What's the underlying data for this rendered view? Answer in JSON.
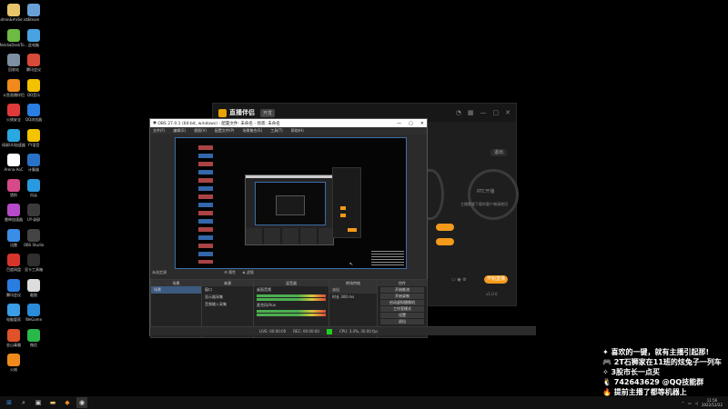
{
  "desktop_icons": [
    {
      "label": "admin&#x6e;istr...",
      "color": "#e8c46a"
    },
    {
      "label": "Steam",
      "color": "#6aa0d8"
    },
    {
      "label": "NvIdiaDeskTo...",
      "color": "#6dbb42"
    },
    {
      "label": "此电脑",
      "color": "#4aa3e0"
    },
    {
      "label": "回收站",
      "color": "#7d8fa0"
    },
    {
      "label": "腾讯会议",
      "color": "#d84a3a"
    },
    {
      "label": "斗鱼直播伴侣",
      "color": "#f08a1c"
    },
    {
      "label": "QQ音乐",
      "color": "#f2c200"
    },
    {
      "label": "火绒安全",
      "color": "#e03a3a"
    },
    {
      "label": "QQ浏览器",
      "color": "#2a7de1"
    },
    {
      "label": "网易UU加速器",
      "color": "#2aa8e0"
    },
    {
      "label": "YY语音",
      "color": "#f5c400"
    },
    {
      "label": "Arena-AoC",
      "color": "#ffffff"
    },
    {
      "label": "计算器",
      "color": "#2a72c8"
    },
    {
      "label": "猎豹",
      "color": "#d64a8a"
    },
    {
      "label": "风云",
      "color": "#2a9ae0"
    },
    {
      "label": "雷神加速器",
      "color": "#b74ac8"
    },
    {
      "label": "UY-录屏",
      "color": "#3a3a3a"
    },
    {
      "label": "迅雷",
      "color": "#3a8ee6"
    },
    {
      "label": "OBS Studio",
      "color": "#444444"
    },
    {
      "label": "百度网盘",
      "color": "#d7352a"
    },
    {
      "label": "显卡工具箱",
      "color": "#2f2f2f"
    },
    {
      "label": "腾讯会议",
      "color": "#2a7de1"
    },
    {
      "label": "截图",
      "color": "#dddddd"
    },
    {
      "label": "电脑管家",
      "color": "#3a9ee6"
    },
    {
      "label": "WeGame",
      "color": "#2a8bd8"
    },
    {
      "label": "金山毒霸",
      "color": "#e0532a"
    },
    {
      "label": "微信",
      "color": "#2ab84a"
    },
    {
      "label": "火绒",
      "color": "#f08a1c"
    }
  ],
  "helper_app": {
    "title": "直播伴侣",
    "badge": "开发",
    "small_btn": "退出",
    "circle_label": "RTC开播",
    "circle_sub": "主播需要下载的客户端请使用",
    "orange_buttons": [
      "",
      ""
    ],
    "start_button": "开始直播",
    "version_text": "v1.0.0"
  },
  "obs": {
    "title_bar": "OBS 27.0.1 (64-bit, windows) - 配置文件: 未命名 - 场景: 未命名",
    "menu": [
      "文件(F)",
      "编辑(E)",
      "视图(V)",
      "配置文件(P)",
      "场景集合(S)",
      "工具(T)",
      "帮助(H)"
    ],
    "scene_toolbar": "未选定源",
    "props_label": "属性",
    "filters_label": "滤镜",
    "docks": {
      "scenes": {
        "title": "场景",
        "items": [
          "场景"
        ]
      },
      "sources": {
        "title": "来源",
        "items": [
          "窗口",
          "显示器采集",
          "音频输入采集"
        ]
      },
      "mixer": {
        "title": "混音器",
        "items": [
          "桌面音频",
          "麦克风/Aux"
        ]
      },
      "transitions": {
        "title": "转场特效",
        "items": [
          "淡出",
          "时长 300 ms"
        ]
      },
      "controls": {
        "title": "控件",
        "buttons": [
          "开始推流",
          "开始录制",
          "启动虚拟摄像机",
          "工作室模式",
          "设置",
          "退出"
        ]
      }
    },
    "status": [
      "LIVE: 00:00:00",
      "REC: 00:00:00",
      "CPU: 3.4%, 30.00 fps"
    ]
  },
  "overlay": {
    "lines": [
      "✦ 喜欢的一键，就有主播引起那!",
      "🎮 2T石狮家在11班的炫兔子一列车",
      "✧ 3股市长一点买",
      "🐧 742643629 @QQ技能群",
      "🔥 提前主播了都等机器上"
    ]
  },
  "taskbar": {
    "clock_time": "11:56",
    "clock_date": "2022/12/22"
  }
}
